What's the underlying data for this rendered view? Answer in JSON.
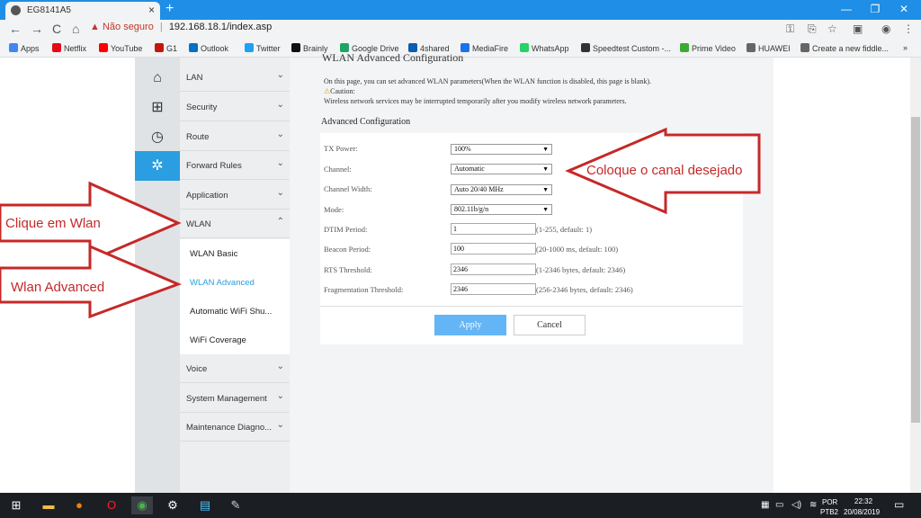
{
  "browser": {
    "tab_title": "EG8141A5",
    "tab_close": "×",
    "new_tab": "+",
    "window_controls": [
      "—",
      "❐",
      "✕"
    ],
    "nav": {
      "back": "←",
      "forward": "→",
      "reload": "C",
      "home": "⌂"
    },
    "security_label": "Não seguro",
    "url": "192.168.18.1/index.asp",
    "bookmarks": [
      {
        "label": "Apps",
        "color": "#4285f4"
      },
      {
        "label": "Netflix",
        "color": "#e50914"
      },
      {
        "label": "YouTube",
        "color": "#ff0000"
      },
      {
        "label": "G1",
        "color": "#c4170c"
      },
      {
        "label": "Outlook",
        "color": "#0072c6"
      },
      {
        "label": "Twitter",
        "color": "#1da1f2"
      },
      {
        "label": "Brainly",
        "color": "#111111"
      },
      {
        "label": "Google Drive",
        "color": "#1fa463"
      },
      {
        "label": "4shared",
        "color": "#0a5db0"
      },
      {
        "label": "MediaFire",
        "color": "#1a73e8"
      },
      {
        "label": "WhatsApp",
        "color": "#25d366"
      },
      {
        "label": "Speedtest Custom -...",
        "color": "#333333"
      },
      {
        "label": "Prime Video",
        "color": "#3aaa35"
      },
      {
        "label": "HUAWEI",
        "color": "#666666"
      },
      {
        "label": "Create a new fiddle...",
        "color": "#666666"
      }
    ],
    "more_bookmarks": "»"
  },
  "sidebar_icons": {
    "home": "⌂",
    "plus": "⊞",
    "clock": "◷",
    "gear": "✲"
  },
  "menu": {
    "items": {
      "lan": "LAN",
      "security": "Security",
      "route": "Route",
      "forward_rules": "Forward Rules",
      "application": "Application",
      "wlan": "WLAN",
      "voice": "Voice",
      "system_management": "System Management",
      "maintenance": "Maintenance Diagno..."
    },
    "wlan_sub": {
      "basic": "WLAN Basic",
      "advanced": "WLAN Advanced",
      "auto_wifi": "Automatic WiFi Shu...",
      "coverage": "WiFi Coverage"
    },
    "chev_down": "⌄",
    "chev_up": "⌃"
  },
  "content": {
    "title": "WLAN Advanced Configuration",
    "intro": "On this page, you can set advanced WLAN parameters(When the WLAN function is disabled, this page is blank).",
    "caution_label": "Caution:",
    "caution_text": "Wireless network services may be interrupted temporarily after you modify wireless network parameters.",
    "section_title": "Advanced Configuration",
    "fields": {
      "tx_power": {
        "label": "TX Power:",
        "value": "100%"
      },
      "channel": {
        "label": "Channel:",
        "value": "Automatic"
      },
      "channel_width": {
        "label": "Channel Width:",
        "value": "Auto 20/40 MHz"
      },
      "mode": {
        "label": "Mode:",
        "value": "802.11b/g/n"
      },
      "dtim": {
        "label": "DTIM Period:",
        "value": "1",
        "hint": "(1-255, default: 1)"
      },
      "beacon": {
        "label": "Beacon Period:",
        "value": "100",
        "hint": "(20-1000 ms, default: 100)"
      },
      "rts": {
        "label": "RTS Threshold:",
        "value": "2346",
        "hint": "(1-2346 bytes, default: 2346)"
      },
      "frag": {
        "label": "Fragmentation Threshold:",
        "value": "2346",
        "hint": "(256-2346 bytes, default: 2346)"
      }
    },
    "dropdown_arrow": "▼",
    "apply": "Apply",
    "cancel": "Cancel"
  },
  "callouts": {
    "click_wlan": "Clique em Wlan",
    "wlan_advanced": "Wlan Advanced",
    "channel_hint": "Coloque o canal desejado",
    "color": "#c62828"
  },
  "taskbar": {
    "language": "POR",
    "layout": "PTB2",
    "time": "22:32",
    "date": "20/08/2019"
  }
}
